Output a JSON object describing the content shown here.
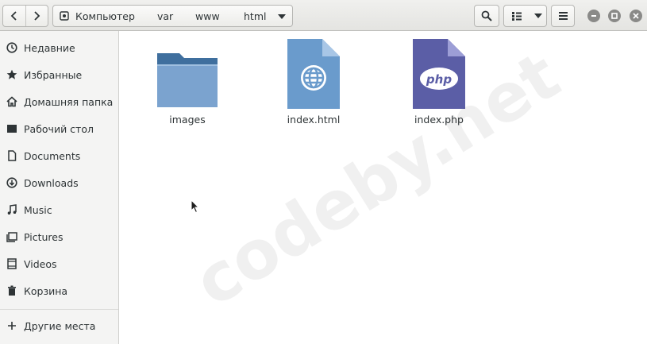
{
  "header": {
    "path": [
      "Компьютер",
      "var",
      "www",
      "html"
    ],
    "icons": {
      "back": "chevron-left-icon",
      "forward": "chevron-right-icon",
      "location": "drive-icon",
      "path_dropdown": "caret-down-icon",
      "search": "search-icon",
      "view": "list-view-icon",
      "view_dropdown": "caret-down-icon",
      "menu": "hamburger-menu-icon",
      "minimize": "minimize-icon",
      "maximize": "maximize-icon",
      "close": "close-icon"
    }
  },
  "sidebar": {
    "items": [
      {
        "label": "Недавние",
        "icon": "clock-icon"
      },
      {
        "label": "Избранные",
        "icon": "star-icon"
      },
      {
        "label": "Домашняя папка",
        "icon": "home-icon"
      },
      {
        "label": "Рабочий стол",
        "icon": "desktop-icon"
      },
      {
        "label": "Documents",
        "icon": "document-icon"
      },
      {
        "label": "Downloads",
        "icon": "download-icon"
      },
      {
        "label": "Music",
        "icon": "music-icon"
      },
      {
        "label": "Pictures",
        "icon": "pictures-icon"
      },
      {
        "label": "Videos",
        "icon": "video-icon"
      },
      {
        "label": "Корзина",
        "icon": "trash-icon"
      }
    ],
    "other_locations": {
      "label": "Другие места",
      "icon": "plus-icon"
    }
  },
  "files": [
    {
      "name": "images",
      "icon": "folder-icon"
    },
    {
      "name": "index.html",
      "icon": "html-file-icon"
    },
    {
      "name": "index.php",
      "icon": "php-file-icon",
      "badge": "php"
    }
  ],
  "watermark": "codeby.net",
  "colors": {
    "folder": "#6f97c5",
    "html_file": "#6a9bcc",
    "php_file": "#5b5ea6"
  }
}
